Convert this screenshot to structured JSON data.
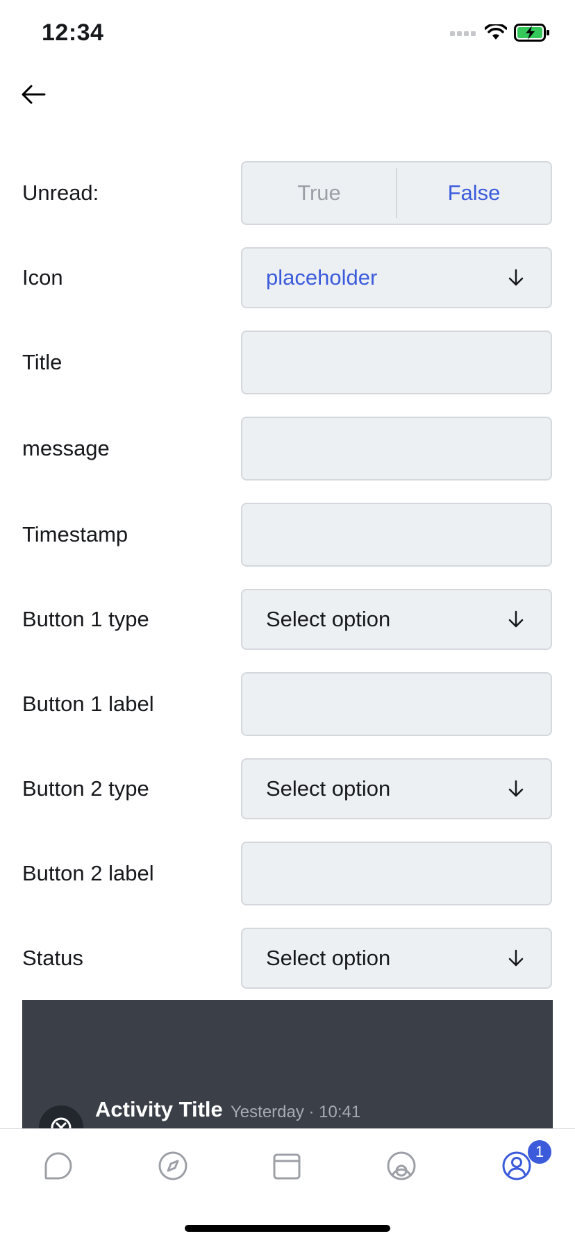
{
  "status_bar": {
    "time": "12:34"
  },
  "form": {
    "unread": {
      "label": "Unread:",
      "options": [
        "True",
        "False"
      ],
      "selected": "False"
    },
    "icon": {
      "label": "Icon",
      "value": "placeholder"
    },
    "title": {
      "label": "Title",
      "value": ""
    },
    "message": {
      "label": "message",
      "value": ""
    },
    "timestamp": {
      "label": "Timestamp",
      "value": ""
    },
    "button1_type": {
      "label": "Button 1 type",
      "value": "Select option"
    },
    "button1_label": {
      "label": "Button 1 label",
      "value": ""
    },
    "button2_type": {
      "label": "Button 2 type",
      "value": "Select option"
    },
    "button2_label": {
      "label": "Button 2 label",
      "value": ""
    },
    "status": {
      "label": "Status",
      "value": "Select option"
    }
  },
  "preview": {
    "title": "Activity Title",
    "time": "Yesterday · 10:41"
  },
  "tabbar": {
    "items": [
      "chat-icon",
      "compass-icon",
      "inbox-icon",
      "channels-icon",
      "profile-icon"
    ],
    "active": "profile-icon",
    "badge": "1"
  },
  "colors": {
    "accent": "#3b5bdb",
    "field_bg": "#edf0f3",
    "dark_card": "#3a3f48"
  }
}
